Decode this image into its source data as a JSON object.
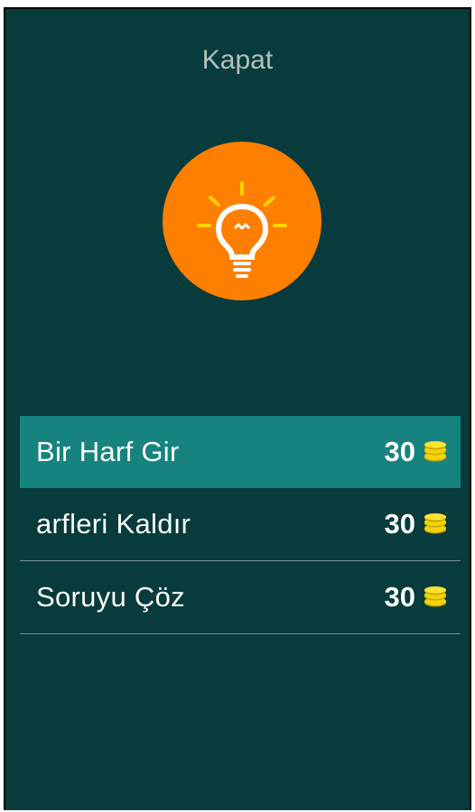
{
  "dialog": {
    "close_label": "Kapat"
  },
  "hint_icon": {
    "name": "lightbulb-icon",
    "circle_color": "#ff7f00"
  },
  "options": [
    {
      "label": "Bir Harf Gir",
      "cost": "30",
      "selected": true
    },
    {
      "label": "arfleri Kaldır",
      "cost": "30",
      "selected": false
    },
    {
      "label": "Soruyu Çöz",
      "cost": "30",
      "selected": false
    }
  ],
  "coin_icon": "coins-icon",
  "colors": {
    "background": "#073b3c",
    "selected_row": "#17837f",
    "coin": "#f2d300"
  }
}
